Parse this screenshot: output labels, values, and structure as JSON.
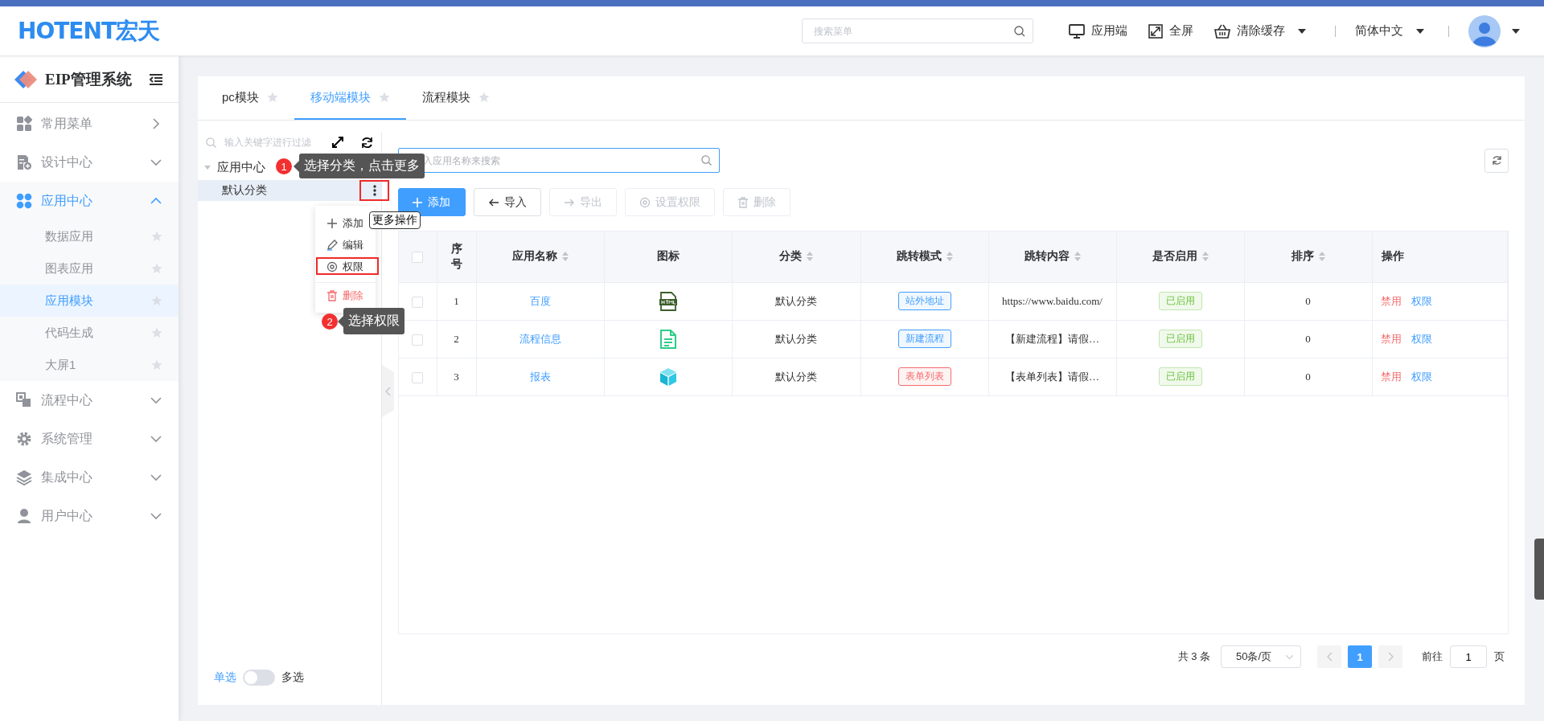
{
  "header": {
    "logo": "HOTENT宏天",
    "search": {
      "placeholder": "搜索菜单"
    },
    "actions": [
      {
        "kind": "monitor",
        "label": "应用端",
        "has_menu": false
      },
      {
        "kind": "fullscreen",
        "label": "全屏",
        "has_menu": false
      },
      {
        "kind": "basket",
        "label": "清除缓存",
        "has_menu": true
      }
    ],
    "language": "简体中文"
  },
  "sidebar": {
    "title": "EIP管理系统",
    "items": [
      {
        "kind": "grid",
        "label": "常用菜单",
        "flyout": true,
        "expanded": false
      },
      {
        "kind": "design",
        "label": "设计中心",
        "flyout": false,
        "expanded": false
      },
      {
        "kind": "apps",
        "label": "应用中心",
        "flyout": false,
        "expanded": true,
        "children": [
          {
            "label": "数据应用",
            "selected": false
          },
          {
            "label": "图表应用",
            "selected": false
          },
          {
            "label": "应用模块",
            "selected": true
          },
          {
            "label": "代码生成",
            "selected": false
          },
          {
            "label": "大屏1",
            "selected": false
          }
        ]
      },
      {
        "kind": "flow",
        "label": "流程中心",
        "flyout": false,
        "expanded": false
      },
      {
        "kind": "gear",
        "label": "系统管理",
        "flyout": false,
        "expanded": false
      },
      {
        "kind": "layers",
        "label": "集成中心",
        "flyout": false,
        "expanded": false
      },
      {
        "kind": "user",
        "label": "用户中心",
        "flyout": false,
        "expanded": false
      }
    ]
  },
  "tabs": [
    {
      "label": "pc模块",
      "selected": false
    },
    {
      "label": "移动端模块",
      "selected": true
    },
    {
      "label": "流程模块",
      "selected": false
    }
  ],
  "tree": {
    "filter_placeholder": "输入关键字进行过滤",
    "nodes": [
      {
        "label": "应用中心",
        "expanded": true,
        "children": [
          {
            "label": "默认分类",
            "selected": true,
            "more_framed": true
          }
        ]
      }
    ],
    "menu": [
      {
        "kind": "add",
        "label": "添加",
        "framed": false
      },
      {
        "kind": "edit",
        "label": "编辑",
        "framed": false
      },
      {
        "kind": "permission",
        "label": "权限",
        "framed": true
      },
      {
        "kind": "delete",
        "label": "删除",
        "framed": false
      }
    ],
    "hover_tip": "更多操作",
    "callouts": [
      {
        "number": "1",
        "text": "选择分类，点击更多"
      },
      {
        "number": "2",
        "text": "选择权限"
      }
    ],
    "mode_switch": {
      "left": "单选",
      "right": "多选",
      "on": false
    }
  },
  "toolbar": {
    "search_placeholder": "入应用名称来搜索",
    "buttons": [
      {
        "kind": "add",
        "label": "添加",
        "primary": true,
        "disabled": false
      },
      {
        "kind": "import",
        "label": "导入",
        "primary": false,
        "disabled": false
      },
      {
        "kind": "export",
        "label": "导出",
        "primary": false,
        "disabled": true
      },
      {
        "kind": "permission",
        "label": "设置权限",
        "primary": false,
        "disabled": true
      },
      {
        "kind": "delete",
        "label": "删除",
        "primary": false,
        "disabled": true
      }
    ]
  },
  "table": {
    "all_checked": false,
    "columns": [
      {
        "label": "序号",
        "sortable": false
      },
      {
        "label": "应用名称",
        "sortable": true
      },
      {
        "label": "图标",
        "sortable": false
      },
      {
        "label": "分类",
        "sortable": true
      },
      {
        "label": "跳转模式",
        "sortable": true
      },
      {
        "label": "跳转内容",
        "sortable": true
      },
      {
        "label": "是否启用",
        "sortable": true
      },
      {
        "label": "排序",
        "sortable": true
      },
      {
        "label": "操作",
        "sortable": false
      }
    ],
    "rows": [
      {
        "checked": false,
        "index": "1",
        "name": "百度",
        "kind": "html",
        "category": "默认分类",
        "mode": {
          "label": "站外地址",
          "color": "#409eff"
        },
        "content": "https://www.baidu.com/",
        "status": "已启用",
        "order": "0",
        "actions": [
          "禁用",
          "权限"
        ]
      },
      {
        "checked": false,
        "index": "2",
        "name": "流程信息",
        "kind": "document",
        "category": "默认分类",
        "mode": {
          "label": "新建流程",
          "color": "#409eff"
        },
        "content": "【新建流程】请假…",
        "status": "已启用",
        "order": "0",
        "actions": [
          "禁用",
          "权限"
        ]
      },
      {
        "checked": false,
        "index": "3",
        "name": "报表",
        "kind": "cube",
        "category": "默认分类",
        "mode": {
          "label": "表单列表",
          "color": "#f56c6c"
        },
        "content": "【表单列表】请假…",
        "status": "已启用",
        "order": "0",
        "actions": [
          "禁用",
          "权限"
        ]
      }
    ]
  },
  "pagination": {
    "total": "共 3 条",
    "page_size": "50条/页",
    "pages": [
      {
        "label": "1",
        "selected": true
      }
    ],
    "goto_label": "前往",
    "goto_value": "1",
    "goto_suffix": "页"
  }
}
